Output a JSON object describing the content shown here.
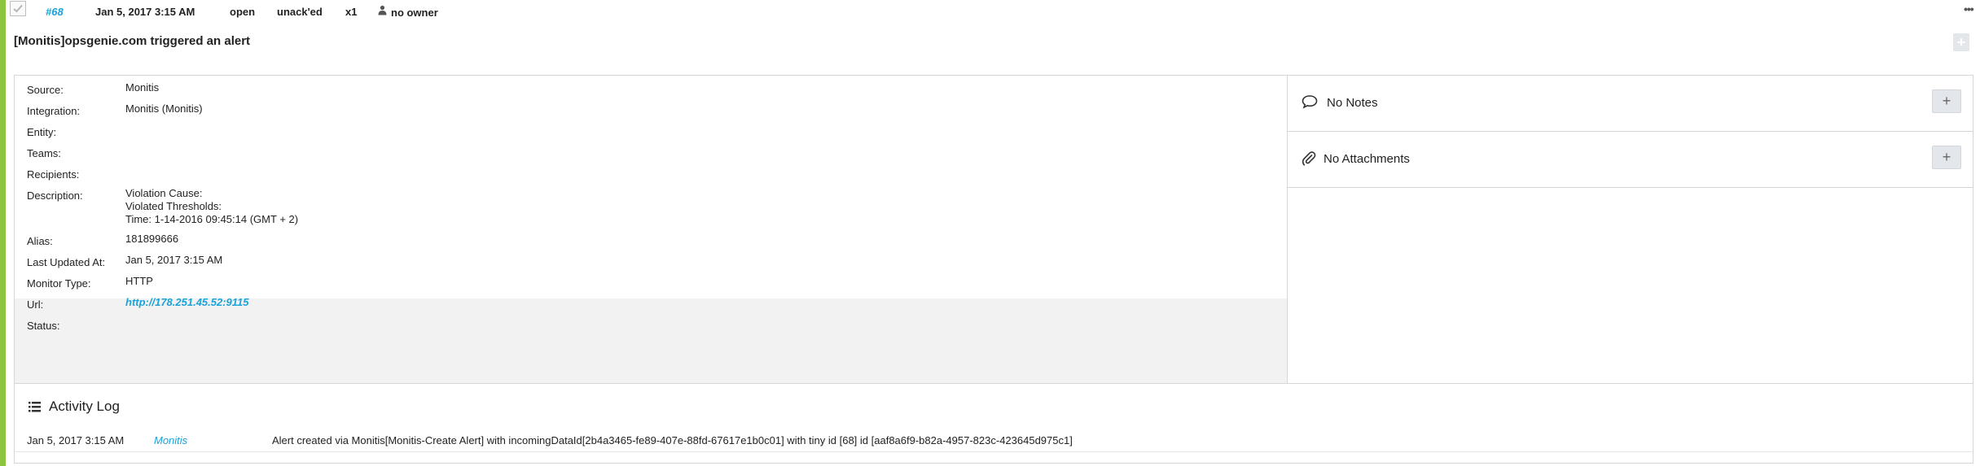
{
  "alert": {
    "id": "#68",
    "created_at": "Jan 5, 2017 3:15 AM",
    "status": "open",
    "ack_status": "unack'ed",
    "count": "x1",
    "owner": "no owner",
    "title": "[Monitis]opsgenie.com triggered an alert"
  },
  "details": {
    "fields": [
      {
        "label": "Source:",
        "value": "Monitis"
      },
      {
        "label": "Integration:",
        "value": "Monitis (Monitis)"
      },
      {
        "label": "Entity:",
        "value": ""
      },
      {
        "label": "Teams:",
        "value": ""
      },
      {
        "label": "Recipients:",
        "value": ""
      },
      {
        "label": "Description:",
        "value_lines": [
          "Violation Cause:",
          "Violated Thresholds:",
          "Time: 1-14-2016 09:45:14 (GMT + 2)"
        ]
      },
      {
        "label": "Alias:",
        "value": "181899666"
      },
      {
        "label": "Last Updated At:",
        "value": "Jan 5, 2017 3:15 AM"
      }
    ],
    "extra_fields": [
      {
        "label": "Monitor Type:",
        "value": "HTTP"
      },
      {
        "label": "Url:",
        "value": "http://178.251.45.52:9115"
      },
      {
        "label": "Status:",
        "value": ""
      }
    ]
  },
  "side": {
    "notes_label": "No Notes",
    "attachments_label": "No Attachments",
    "add_label": "+"
  },
  "activity": {
    "title": "Activity Log",
    "entries": [
      {
        "time": "Jan 5, 2017 3:15 AM",
        "user": "Monitis",
        "message": "Alert created via Monitis[Monitis-Create Alert] with incomingDataId[2b4a3465-fe89-407e-88fd-67617e1b0c01] with tiny id [68] id [aaf8a6f9-b82a-4957-823c-423645d975c1]"
      }
    ]
  },
  "icons": {
    "more": "more-dots-icon",
    "owner": "user-icon",
    "notes": "comment-icon",
    "attachments": "paperclip-icon",
    "activity": "list-icon",
    "checkbox": "checkmark-icon"
  },
  "colors": {
    "accent": "#8cc63f",
    "link": "#1aa3d9",
    "shaded_row": "#f2f2f2"
  }
}
